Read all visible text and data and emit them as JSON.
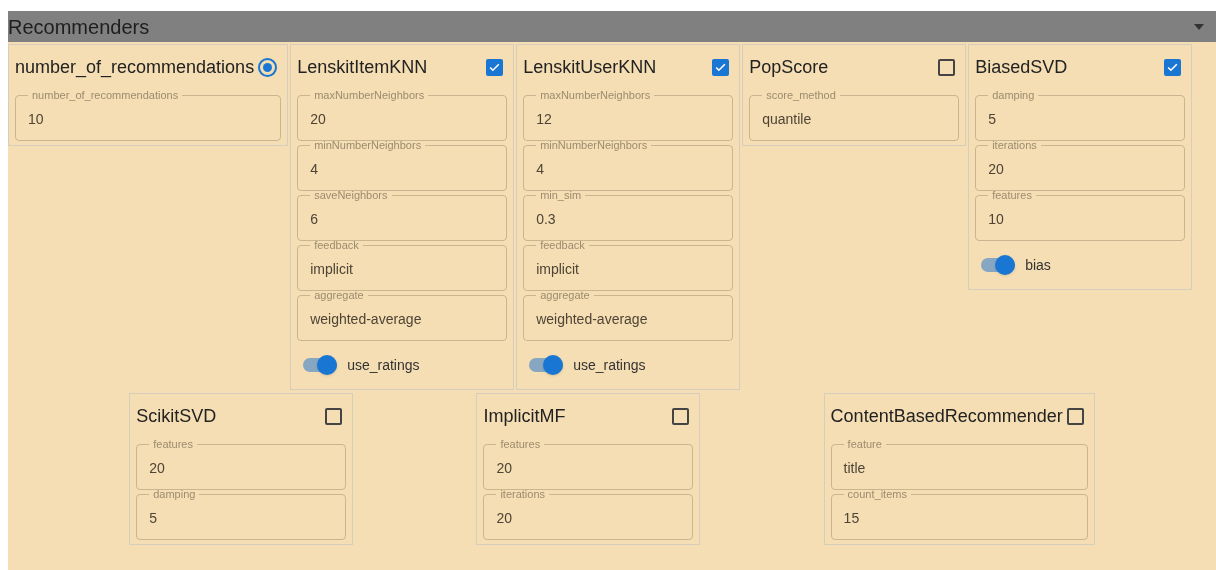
{
  "panel": {
    "title": "Recommenders",
    "expanded": true
  },
  "rows": [
    [
      {
        "name": "number_of_recommendations",
        "kind": "radio",
        "selected": true,
        "params": [
          {
            "kind": "field",
            "label": "number_of_recommendations",
            "value": "10"
          }
        ]
      },
      {
        "name": "LenskitItemKNN",
        "kind": "checkbox",
        "checked": true,
        "params": [
          {
            "kind": "field",
            "label": "maxNumberNeighbors",
            "value": "20"
          },
          {
            "kind": "field",
            "label": "minNumberNeighbors",
            "value": "4"
          },
          {
            "kind": "field",
            "label": "saveNeighbors",
            "value": "6"
          },
          {
            "kind": "field",
            "label": "feedback",
            "value": "implicit"
          },
          {
            "kind": "field",
            "label": "aggregate",
            "value": "weighted-average"
          },
          {
            "kind": "switch",
            "label": "use_ratings",
            "on": true
          }
        ]
      },
      {
        "name": "LenskitUserKNN",
        "kind": "checkbox",
        "checked": true,
        "params": [
          {
            "kind": "field",
            "label": "maxNumberNeighbors",
            "value": "12"
          },
          {
            "kind": "field",
            "label": "minNumberNeighbors",
            "value": "4"
          },
          {
            "kind": "field",
            "label": "min_sim",
            "value": "0.3"
          },
          {
            "kind": "field",
            "label": "feedback",
            "value": "implicit"
          },
          {
            "kind": "field",
            "label": "aggregate",
            "value": "weighted-average"
          },
          {
            "kind": "switch",
            "label": "use_ratings",
            "on": true
          }
        ]
      },
      {
        "name": "PopScore",
        "kind": "checkbox",
        "checked": false,
        "params": [
          {
            "kind": "field",
            "label": "score_method",
            "value": "quantile"
          }
        ]
      },
      {
        "name": "BiasedSVD",
        "kind": "checkbox",
        "checked": true,
        "params": [
          {
            "kind": "field",
            "label": "damping",
            "value": "5"
          },
          {
            "kind": "field",
            "label": "iterations",
            "value": "20"
          },
          {
            "kind": "field",
            "label": "features",
            "value": "10"
          },
          {
            "kind": "switch",
            "label": "bias",
            "on": true
          }
        ]
      }
    ],
    [
      {
        "name": "ScikitSVD",
        "kind": "checkbox",
        "checked": false,
        "params": [
          {
            "kind": "field",
            "label": "features",
            "value": "20"
          },
          {
            "kind": "field",
            "label": "damping",
            "value": "5"
          }
        ]
      },
      {
        "name": "ImplicitMF",
        "kind": "checkbox",
        "checked": false,
        "params": [
          {
            "kind": "field",
            "label": "features",
            "value": "20"
          },
          {
            "kind": "field",
            "label": "iterations",
            "value": "20"
          }
        ]
      },
      {
        "name": "ContentBasedRecommender",
        "kind": "checkbox",
        "checked": false,
        "params": [
          {
            "kind": "field",
            "label": "feature",
            "value": "title"
          },
          {
            "kind": "field",
            "label": "count_items",
            "value": "15"
          }
        ]
      }
    ]
  ]
}
